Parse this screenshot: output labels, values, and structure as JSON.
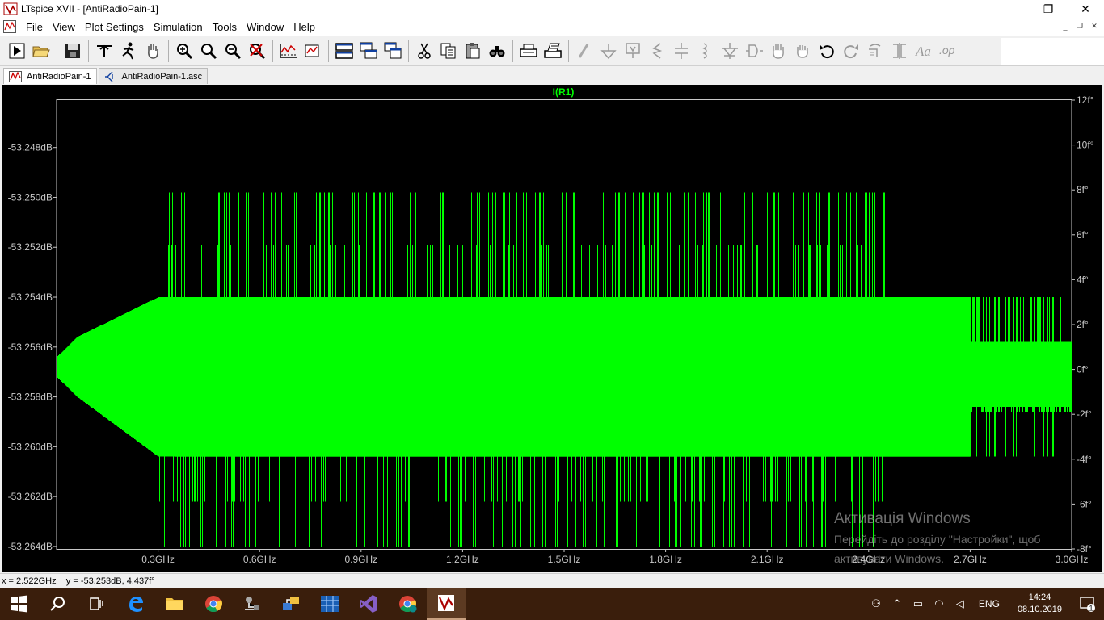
{
  "window": {
    "title": "LTspice XVII - [AntiRadioPain-1]",
    "minimize_glyph": "—",
    "maximize_glyph": "❐",
    "close_glyph": "✕"
  },
  "menu": {
    "items": [
      "File",
      "View",
      "Plot Settings",
      "Simulation",
      "Tools",
      "Window",
      "Help"
    ],
    "mdi_minimize": "_",
    "mdi_restore": "❐",
    "mdi_close": "✕"
  },
  "toolbar": {
    "icons": [
      "run-icon",
      "open-icon",
      "save-icon",
      "control-panel-icon",
      "halt-icon",
      "pan-icon",
      "zoom-in-icon",
      "zoom-full-icon",
      "zoom-out-icon",
      "zoom-cancel-icon",
      "autorange-icon",
      "marker-icon",
      "tile-horizontal-icon",
      "cascade-icon",
      "tile-vertical-icon",
      "cut-icon",
      "copy-icon",
      "paste-icon",
      "find-icon",
      "print-icon",
      "print-setup-icon",
      "wire-icon",
      "ground-icon",
      "label-icon",
      "resistor-icon",
      "capacitor-icon",
      "inductor-icon",
      "diode-icon",
      "component-icon",
      "move-icon",
      "drag-icon",
      "undo-icon",
      "redo-icon",
      "rotate-icon",
      "mirror-icon",
      "text-icon",
      "spice-directive-icon"
    ]
  },
  "tabs": [
    {
      "label": "AntiRadioPain-1",
      "icon": "waveform-icon",
      "active": true
    },
    {
      "label": "AntiRadioPain-1.asc",
      "icon": "schematic-icon",
      "active": false
    }
  ],
  "colors": {
    "trace": "#00ff00",
    "plot_bg": "#000000",
    "axis": "#c8c8c8",
    "grid_tick": "#00ff00"
  },
  "chart_data": {
    "type": "line",
    "title": "I(R1)",
    "xlabel": "",
    "ylabel": "",
    "x_ticks": [
      "0.3GHz",
      "0.6GHz",
      "0.9GHz",
      "1.2GHz",
      "1.5GHz",
      "1.8GHz",
      "2.1GHz",
      "2.4GHz",
      "2.7GHz",
      "3.0GHz"
    ],
    "xlim": [
      0.0,
      3.0
    ],
    "x_unit": "GHz",
    "left_ticks": [
      "-53.248dB",
      "-53.250dB",
      "-53.252dB",
      "-53.254dB",
      "-53.256dB",
      "-53.258dB",
      "-53.260dB",
      "-53.262dB",
      "-53.264dB"
    ],
    "ylim_left": [
      -53.2641,
      -53.2461
    ],
    "right_ticks": [
      "12f°",
      "10f°",
      "8f°",
      "6f°",
      "4f°",
      "2f°",
      "0f°",
      "-2f°",
      "-4f°",
      "-6f°",
      "-8f°"
    ],
    "ylim_right": [
      -8,
      12
    ],
    "series": [
      {
        "name": "I(R1)",
        "description_values": {
          "magnitude_dense_band_dB": [
            -53.2604,
            -53.254
          ],
          "magnitude_outer_band_dB": [
            -53.264,
            -53.2498
          ],
          "magnitude_start_dB": -53.2568
        }
      }
    ]
  },
  "status": {
    "cursor_readout": "x = 2.522GHz    y = -53.253dB, 4.437f°"
  },
  "taskbar": {
    "apps": [
      "windows-start-icon",
      "search-icon",
      "task-view-icon",
      "edge-icon",
      "file-explorer-icon",
      "chrome-icon",
      "network-tool-icon",
      "network-config-icon",
      "app-grid-icon",
      "visual-studio-icon",
      "chrome-alt-icon",
      "ltspice-icon"
    ],
    "lang": "ENG",
    "time": "14:24",
    "date": "08.10.2019",
    "notif_count": "1"
  },
  "watermark": {
    "line1": "Активація Windows",
    "line2": "Перейдіть до розділу \"Настройки\", щоб",
    "line3": "активувати Windows."
  }
}
